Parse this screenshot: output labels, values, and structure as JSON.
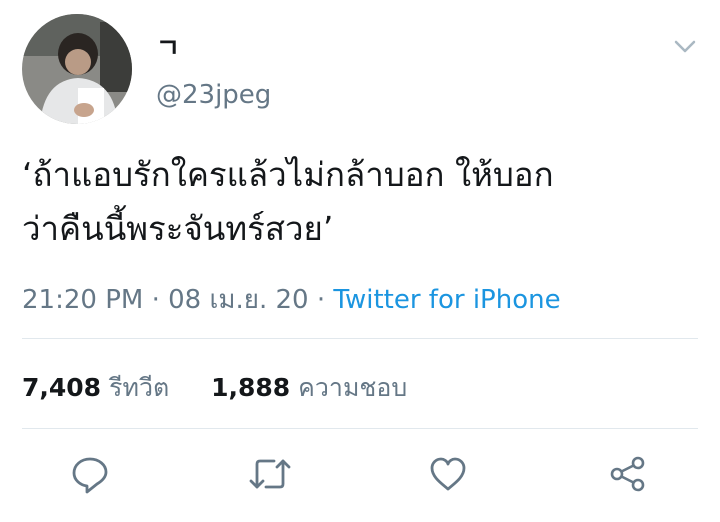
{
  "user": {
    "display_name": "ㄱ",
    "handle": "@23jpeg"
  },
  "tweet": {
    "text": "‘ถ้าแอบรักใครแล้วไม่กล้าบอก ให้บอก\nว่าคืนนี้พระจันทร์สวย’",
    "time": "21:20 PM",
    "sep1": "·",
    "date": "08 เม.ย. 20",
    "sep2": "·",
    "source": "Twitter for iPhone"
  },
  "stats": {
    "retweets_count": "7,408",
    "retweets_label": "รีทวีต",
    "likes_count": "1,888",
    "likes_label": "ความชอบ"
  },
  "colors": {
    "text": "#14171a",
    "secondary": "#657786",
    "link": "#1b95e0",
    "divider": "#e1e8ed"
  },
  "icons": [
    "chevron-down-icon",
    "reply-icon",
    "retweet-icon",
    "like-icon",
    "share-icon"
  ]
}
